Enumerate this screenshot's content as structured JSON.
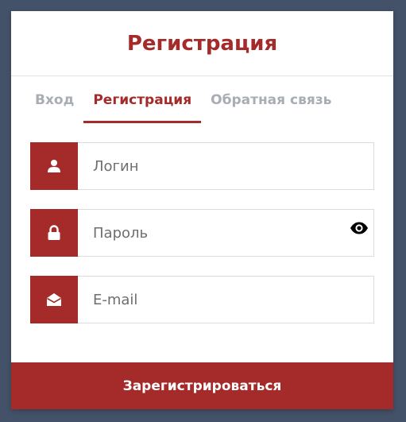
{
  "header": {
    "title": "Регистрация"
  },
  "tabs": [
    {
      "label": "Вход",
      "active": false
    },
    {
      "label": "Регистрация",
      "active": true
    },
    {
      "label": "Обратная связь",
      "active": false
    }
  ],
  "form": {
    "login": {
      "placeholder": "Логин",
      "value": "",
      "icon": "user-icon"
    },
    "password": {
      "placeholder": "Пароль",
      "value": "",
      "icon": "lock-icon",
      "toggle_icon": "eye-icon"
    },
    "email": {
      "placeholder": "E-mail",
      "value": "",
      "icon": "envelope-open-icon"
    }
  },
  "submit": {
    "label": "Зарегистрироваться"
  },
  "colors": {
    "accent": "#a52a2a",
    "background": "#435268",
    "inactive_tab": "#a8adb4"
  }
}
